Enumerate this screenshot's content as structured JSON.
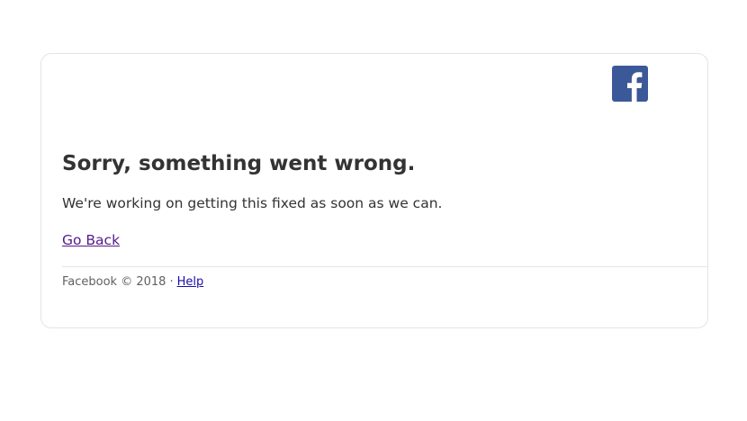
{
  "brand": {
    "icon": "facebook-logo-icon",
    "color": "#3b5998",
    "glyph": "f"
  },
  "error": {
    "title": "Sorry, something went wrong.",
    "message": "We're working on getting this fixed as soon as we can.",
    "go_back_label": "Go Back"
  },
  "footer": {
    "copyright": "Facebook © 2018",
    "separator": "·",
    "help_label": "Help"
  }
}
